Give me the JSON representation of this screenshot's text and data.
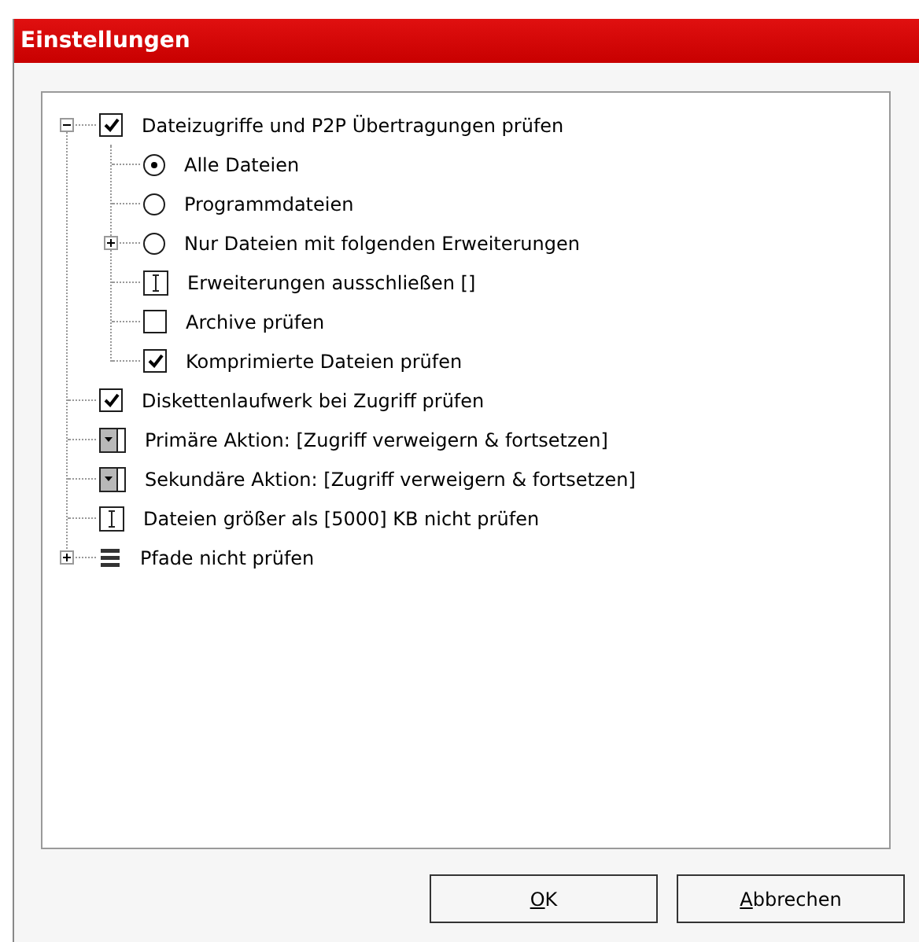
{
  "window": {
    "title": "Einstellungen"
  },
  "tree": [
    {
      "kind": "checkbox",
      "label": "Dateizugriffe und P2P Übertragungen prüfen",
      "checked": true,
      "expanded": true,
      "children": [
        {
          "kind": "radio",
          "label": "Alle Dateien",
          "selected": true
        },
        {
          "kind": "radio",
          "label": "Programmdateien",
          "selected": false
        },
        {
          "kind": "radio",
          "label": "Nur Dateien mit folgenden Erweiterungen",
          "selected": false,
          "expanded": false
        },
        {
          "kind": "text",
          "label": "Erweiterungen ausschließen []"
        },
        {
          "kind": "checkbox",
          "label": "Archive prüfen",
          "checked": false
        },
        {
          "kind": "checkbox",
          "label": "Komprimierte Dateien prüfen",
          "checked": true
        }
      ]
    },
    {
      "kind": "checkbox",
      "label": "Diskettenlaufwerk bei Zugriff prüfen",
      "checked": true
    },
    {
      "kind": "dropdown",
      "label": "Primäre Aktion: [Zugriff verweigern & fortsetzen]"
    },
    {
      "kind": "dropdown",
      "label": "Sekundäre Aktion: [Zugriff verweigern & fortsetzen]"
    },
    {
      "kind": "text",
      "label": "Dateien größer als [5000] KB nicht prüfen"
    },
    {
      "kind": "list",
      "label": "Pfade nicht prüfen",
      "expanded": false
    }
  ],
  "buttons": [
    {
      "label": "OK"
    },
    {
      "label": "Abbrechen"
    }
  ]
}
